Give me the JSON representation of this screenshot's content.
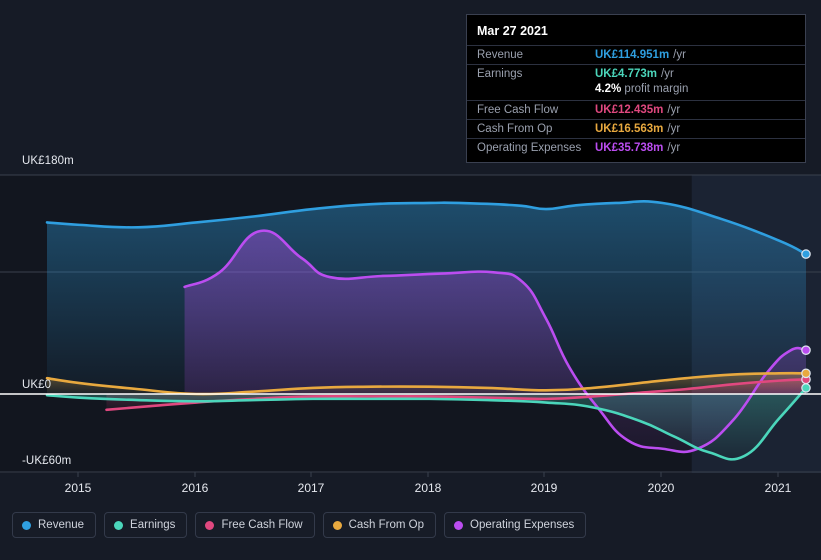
{
  "theme": {
    "background": "#161b26",
    "plot_background": "#12161f",
    "grid": "#39404e",
    "zero_line": "#ffffff",
    "axis_text": "#e6e9ef"
  },
  "tooltip": {
    "date": "Mar 27 2021",
    "rows": [
      {
        "key": "Revenue",
        "value": "UK£114.951m",
        "unit": "/yr",
        "color": "#2f9fe0"
      },
      {
        "key": "Earnings",
        "value": "UK£4.773m",
        "unit": "/yr",
        "color": "#4bd6bb"
      },
      {
        "key": "Free Cash Flow",
        "value": "UK£12.435m",
        "unit": "/yr",
        "color": "#e0487f"
      },
      {
        "key": "Cash From Op",
        "value": "UK£16.563m",
        "unit": "/yr",
        "color": "#e8a93f"
      },
      {
        "key": "Operating Expenses",
        "value": "UK£35.738m",
        "unit": "/yr",
        "color": "#bb4df0"
      }
    ],
    "margin_value": "4.2%",
    "margin_label": "profit margin"
  },
  "legend": {
    "items": [
      {
        "label": "Revenue",
        "color": "#2f9fe0"
      },
      {
        "label": "Earnings",
        "color": "#4bd6bb"
      },
      {
        "label": "Free Cash Flow",
        "color": "#e0487f"
      },
      {
        "label": "Cash From Op",
        "color": "#e8a93f"
      },
      {
        "label": "Operating Expenses",
        "color": "#bb4df0"
      }
    ]
  },
  "chart_data": {
    "type": "area",
    "title": "",
    "xlabel": "",
    "ylabel": "",
    "currency": "UK£",
    "unit": "m",
    "grid": true,
    "legend_position": "bottom",
    "x_tick_labels": [
      "2015",
      "2016",
      "2017",
      "2018",
      "2019",
      "2020",
      "2021"
    ],
    "y_tick_labels": [
      "UK£180m",
      "UK£0",
      "-UK£60m"
    ],
    "ylim": [
      -60,
      180
    ],
    "xlim": [
      "2014.72",
      "2021.23"
    ],
    "highlight_from": "2020.25",
    "series": [
      {
        "name": "Revenue",
        "color": "#2f9fe0",
        "x": [
          2014.72,
          2015.0,
          2015.5,
          2016.0,
          2016.5,
          2017.0,
          2017.5,
          2018.0,
          2018.25,
          2018.75,
          2019.0,
          2019.25,
          2019.6,
          2020.0,
          2020.5,
          2021.0,
          2021.23
        ],
        "values": [
          141,
          139,
          137,
          141,
          146,
          152,
          156,
          157,
          157,
          155,
          152,
          155,
          157,
          157,
          144,
          126,
          115
        ]
      },
      {
        "name": "Earnings",
        "color": "#4bd6bb",
        "x": [
          2014.72,
          2015.0,
          2015.5,
          2016.0,
          2016.5,
          2017.0,
          2017.5,
          2018.0,
          2018.5,
          2019.0,
          2019.4,
          2019.8,
          2020.1,
          2020.4,
          2020.7,
          2021.0,
          2021.23
        ],
        "values": [
          -1,
          -3,
          -5,
          -6,
          -5,
          -4,
          -4,
          -4,
          -5,
          -7,
          -11,
          -22,
          -35,
          -48,
          -51,
          -20,
          5
        ]
      },
      {
        "name": "Free Cash Flow",
        "color": "#e0487f",
        "x": [
          2015.23,
          2015.6,
          2016.0,
          2016.5,
          2017.0,
          2017.5,
          2018.0,
          2018.5,
          2019.0,
          2019.4,
          2019.8,
          2020.2,
          2020.6,
          2021.0,
          2021.23
        ],
        "values": [
          -13,
          -10,
          -7,
          -4,
          -2,
          -2,
          -2,
          -3,
          -4,
          -2,
          1,
          4,
          8,
          11,
          12
        ]
      },
      {
        "name": "Cash From Op",
        "color": "#e8a93f",
        "x": [
          2014.72,
          2015.0,
          2015.5,
          2016.0,
          2016.5,
          2017.0,
          2017.5,
          2018.0,
          2018.5,
          2019.0,
          2019.4,
          2019.8,
          2020.2,
          2020.6,
          2021.0,
          2021.23
        ],
        "values": [
          13,
          9,
          4,
          0,
          2,
          5,
          6,
          6,
          5,
          3,
          5,
          9,
          13,
          16,
          17,
          17
        ]
      },
      {
        "name": "Operating Expenses",
        "color": "#bb4df0",
        "x": [
          2015.9,
          2016.2,
          2016.55,
          2016.9,
          2017.15,
          2017.6,
          2018.1,
          2018.55,
          2018.8,
          2019.0,
          2019.2,
          2019.45,
          2019.7,
          2020.0,
          2020.3,
          2020.6,
          2020.9,
          2021.1,
          2021.23
        ],
        "values": [
          88,
          100,
          134,
          112,
          96,
          97,
          99,
          100,
          92,
          62,
          22,
          -12,
          -38,
          -45,
          -45,
          -22,
          18,
          36,
          36
        ]
      }
    ]
  }
}
